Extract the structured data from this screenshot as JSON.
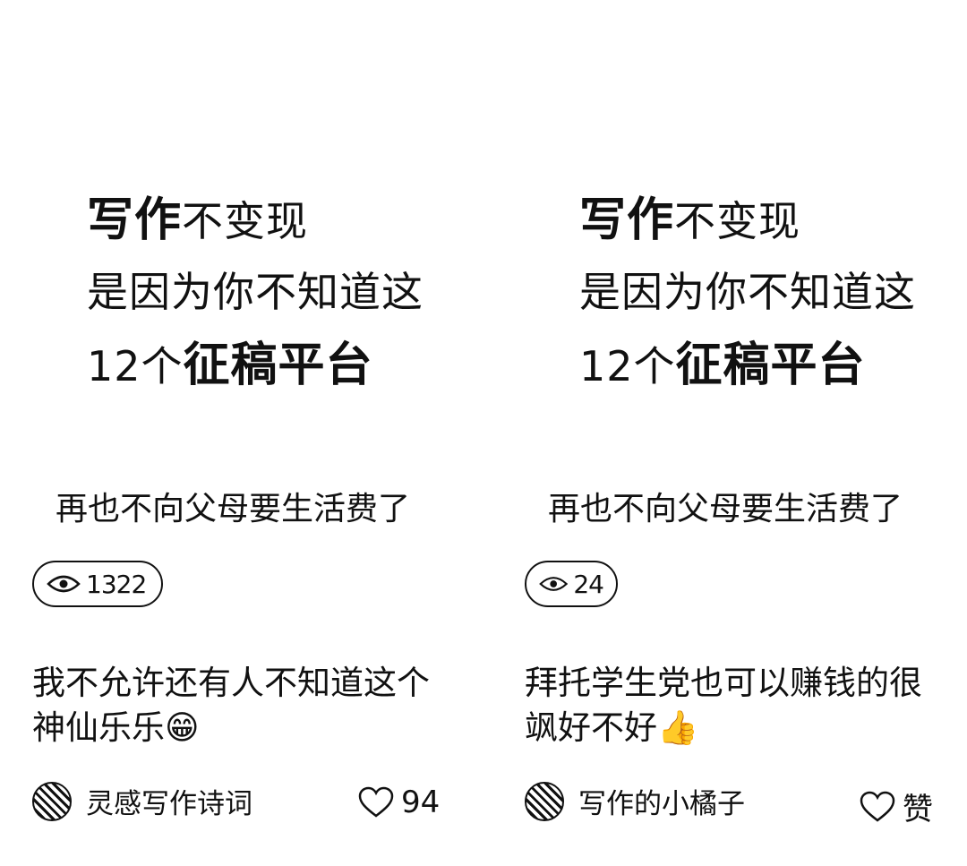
{
  "cards": [
    {
      "cover": {
        "line1_bold": "写作",
        "line1_rest": "不变现",
        "line2": "是因为你不知道这",
        "line3_prefix": "12个",
        "line3_bold": "征稿平台"
      },
      "subtitle": "再也不向父母要生活费了",
      "views": "1322",
      "title": "我不允许还有人不知道这个神仙乐乐😁",
      "author": "灵感写作诗词",
      "likes": "94"
    },
    {
      "cover": {
        "line1_bold": "写作",
        "line1_rest": "不变现",
        "line2": "是因为你不知道这",
        "line3_prefix": "12个",
        "line3_bold": "征稿平台"
      },
      "subtitle": "再也不向父母要生活费了",
      "views": "24",
      "title": "拜托学生党也可以赚钱的很飒好不好👍",
      "author": "写作的小橘子",
      "likes": "赞"
    }
  ],
  "icons": {
    "eye": "eye-icon",
    "heart": "heart-outline-icon",
    "avatar": "avatar-image"
  }
}
